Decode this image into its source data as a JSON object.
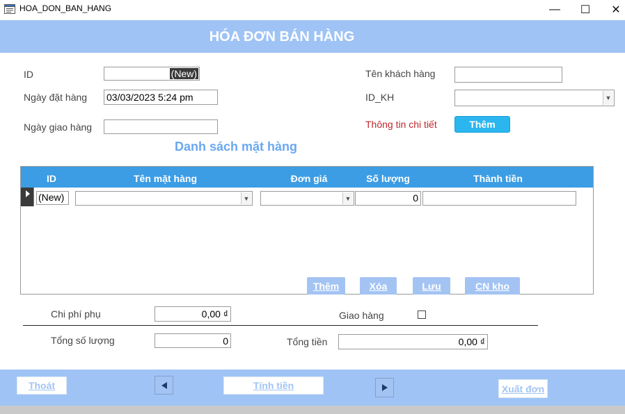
{
  "window": {
    "title": "HOA_DON_BAN_HANG",
    "minimize_glyph": "—",
    "maximize_glyph": "☐",
    "close_glyph": "✕"
  },
  "form": {
    "title": "HÓA ĐƠN BÁN HÀNG",
    "id_label": "ID",
    "id_value": "(New)",
    "order_date_label": "Ngày đặt hàng",
    "order_date_value": "03/03/2023 5:24 pm",
    "delivery_date_label": "Ngày giao hàng",
    "delivery_date_value": "",
    "customer_name_label": "Tên khách hàng",
    "customer_name_value": "",
    "customer_id_label": "ID_KH",
    "customer_id_value": "",
    "detail_label": "Thông tin chi tiết",
    "add_customer_button": "Thêm"
  },
  "items": {
    "heading": "Danh sách mặt hàng",
    "columns": [
      "ID",
      "Tên mặt hàng",
      "Đơn giá",
      "Số lượng",
      "Thành tiền"
    ],
    "new_row": {
      "id": "(New)",
      "name": "",
      "price": "",
      "quantity": "0",
      "total": ""
    },
    "buttons": {
      "add": "Thêm",
      "delete": "Xóa",
      "save": "Lưu",
      "update_stock": "CN kho"
    }
  },
  "summary": {
    "extra_cost_label": "Chi phí phụ",
    "extra_cost_value": "0,00 ₫",
    "delivery_label": "Giao hàng",
    "delivery_checked": false,
    "total_qty_label": "Tổng số lượng",
    "total_qty_value": "0",
    "total_amount_label": "Tổng tiền",
    "total_amount_value": "0,00 ₫"
  },
  "footer": {
    "exit_button": "Thoát",
    "calculate_button": "Tính tiền",
    "export_button": "Xuất đơn"
  },
  "colors": {
    "header_band": "#9fc3f5",
    "subform_header": "#3c9de4",
    "cyan_button": "#2bb6ef",
    "detail_label": "#c0282d",
    "heading_text": "#6aa8f0"
  }
}
